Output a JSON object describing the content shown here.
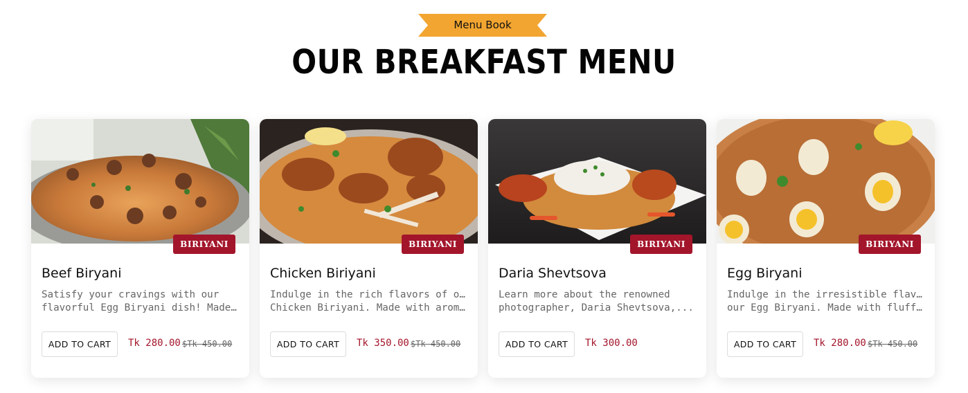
{
  "header": {
    "ribbon_label": "Menu Book",
    "title": "OUR BREAKFAST MENU",
    "ribbon_color": "#f2a530"
  },
  "accent_color": "#a3152b",
  "cards": [
    {
      "image_name": "beef-biryani-photo",
      "badge": "BIRIYANI",
      "title": "Beef Biryani",
      "desc_line1": "Satisfy your cravings with our",
      "desc_line2": "flavorful Egg Biryani dish! Made with...",
      "button": "ADD TO CART",
      "price": "Tk 280.00",
      "old_price": "$Tk 450.00"
    },
    {
      "image_name": "chicken-biryani-photo",
      "badge": "BIRIYANI",
      "title": "Chicken Biriyani",
      "desc_line1": "Indulge in the rich flavors of our",
      "desc_line2": "Chicken Biriyani. Made with aromati...",
      "button": "ADD TO CART",
      "price": "Tk 350.00",
      "old_price": "$Tk 450.00"
    },
    {
      "image_name": "chicken-tandoori-biryani-photo",
      "badge": "BIRIYANI",
      "title": "Daria Shevtsova",
      "desc_line1": "Learn more about the renowned",
      "desc_line2": "photographer, Daria Shevtsova,...",
      "button": "ADD TO CART",
      "price": "Tk 300.00",
      "old_price": ""
    },
    {
      "image_name": "egg-biryani-photo",
      "badge": "BIRIYANI",
      "title": "Egg Biryani",
      "desc_line1": "Indulge in the irresistible flavors of",
      "desc_line2": "our Egg Biryani. Made with fluffy ric...",
      "button": "ADD TO CART",
      "price": "Tk 280.00",
      "old_price": "$Tk 450.00"
    }
  ]
}
